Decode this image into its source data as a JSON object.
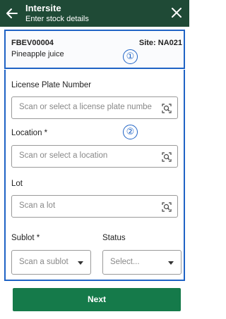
{
  "header": {
    "title": "Intersite",
    "subtitle": "Enter stock details",
    "back_icon": "arrow-left-icon",
    "close_icon": "close-icon",
    "background": "#1f4a36"
  },
  "product": {
    "sku": "FBEV00004",
    "site": "Site: NA021",
    "name": "Pineapple juice"
  },
  "annotations": {
    "marker_1": "①",
    "marker_2": "②",
    "color": "#1f63c5"
  },
  "form": {
    "license_plate": {
      "label": "License Plate Number",
      "placeholder": "Scan or select a license plate numbe"
    },
    "location": {
      "label": "Location *",
      "placeholder": "Scan or select a location"
    },
    "lot": {
      "label": "Lot",
      "placeholder": "Scan a lot"
    },
    "sublot": {
      "label": "Sublot *",
      "placeholder": "Scan a sublot"
    },
    "status": {
      "label": "Status",
      "placeholder": "Select..."
    }
  },
  "footer": {
    "next_label": "Next",
    "accent": "#157a4a"
  }
}
